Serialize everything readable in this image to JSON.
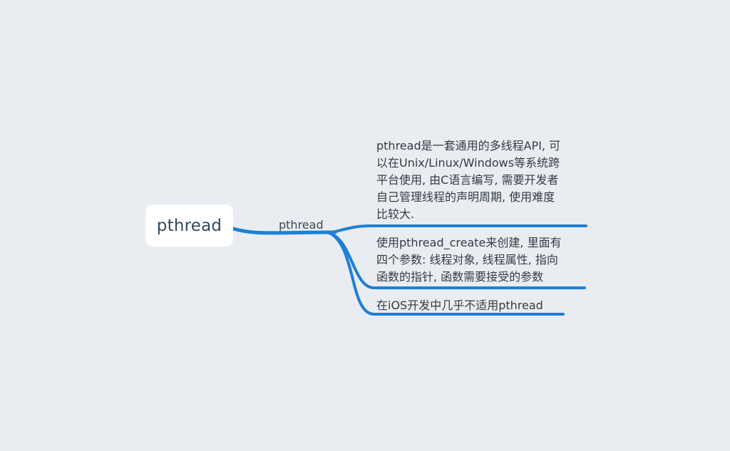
{
  "mindmap": {
    "root": {
      "label": "pthread"
    },
    "branch": {
      "label": "pthread"
    },
    "leaves": [
      {
        "lines": [
          "pthread是一套通用的多线程API, 可",
          "以在Unix/Linux/Windows等系统跨",
          "平台使用, 由C语言编写, 需要开发者",
          "自己管理线程的声明周期, 使用难度",
          "比较大."
        ]
      },
      {
        "lines": [
          "使用pthread_create来创建, 里面有",
          "四个参数: 线程对象, 线程属性, 指向",
          "函数的指针, 函数需要接受的参数"
        ]
      },
      {
        "lines": [
          "在iOS开发中几乎不适用pthread"
        ]
      }
    ],
    "colors": {
      "background": "#e9ecf0",
      "connector": "#1e7fd6",
      "node": "#ffffff"
    }
  }
}
